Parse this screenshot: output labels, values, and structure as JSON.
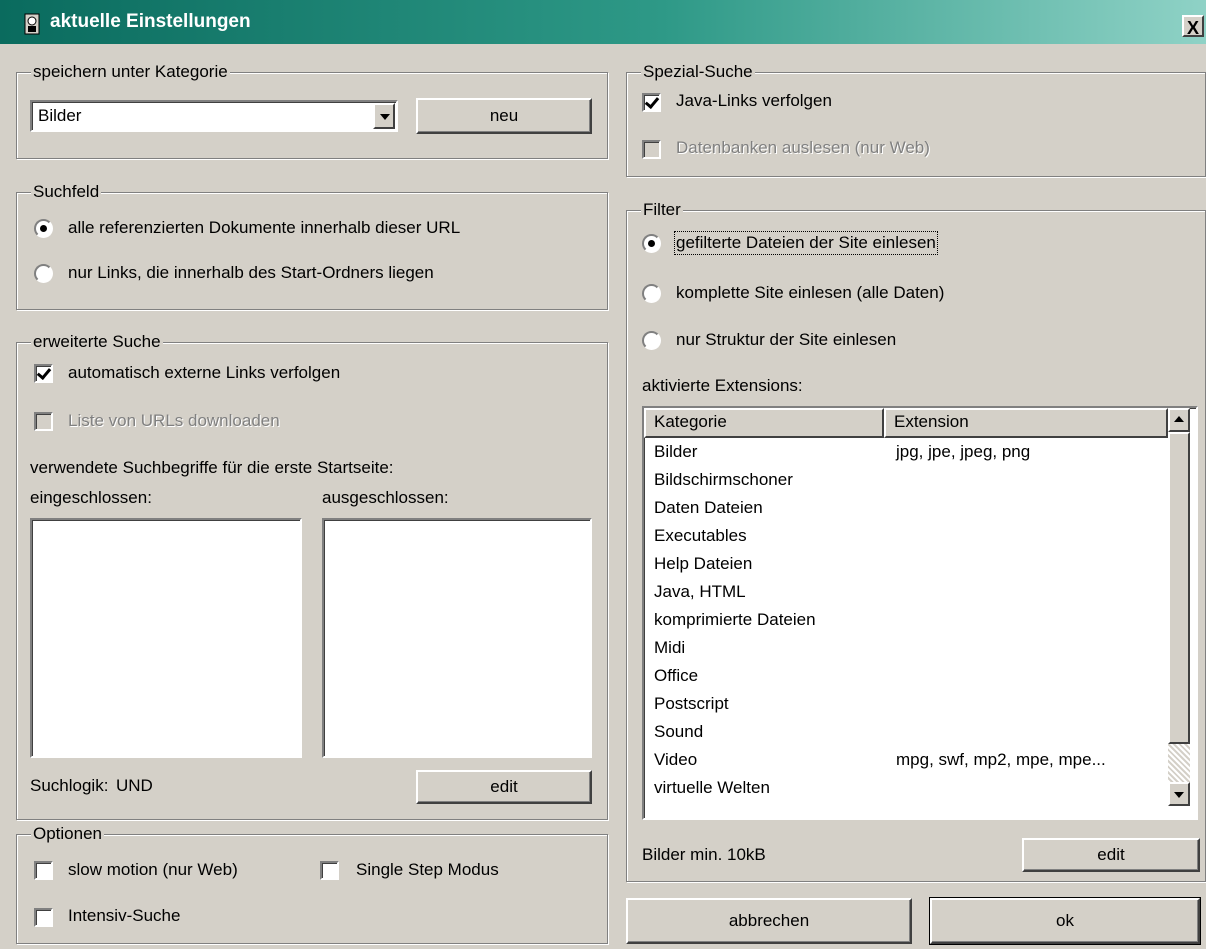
{
  "window": {
    "title": "aktuelle Einstellungen",
    "close_label": "X",
    "title_colors": [
      "#0a6b5e",
      "#2e9987",
      "#8fd2c6"
    ]
  },
  "kategorie": {
    "legend": "speichern unter Kategorie",
    "selected": "Bilder",
    "new_label": "neu"
  },
  "suchfeld": {
    "legend": "Suchfeld",
    "options": [
      {
        "label": "alle referenzierten Dokumente innerhalb dieser URL",
        "checked": true
      },
      {
        "label": "nur Links, die innerhalb des Start-Ordners liegen",
        "checked": false
      }
    ]
  },
  "erweitert": {
    "legend": "erweiterte Suche",
    "auto_links_label": "automatisch externe Links verfolgen",
    "auto_links_checked": true,
    "url_list_label": "Liste von URLs downloaden",
    "url_list_enabled": false,
    "terms_caption": "verwendete Suchbegriffe für die erste Startseite:",
    "included_label": "eingeschlossen:",
    "excluded_label": "ausgeschlossen:",
    "logic_label": "Suchlogik:",
    "logic_value": "UND",
    "edit_label": "edit"
  },
  "optionen": {
    "legend": "Optionen",
    "slow_motion_label": "slow motion (nur Web)",
    "single_step_label": "Single Step Modus",
    "intensive_label": "Intensiv-Suche"
  },
  "spezial": {
    "legend": "Spezial-Suche",
    "java_label": "Java-Links verfolgen",
    "java_checked": true,
    "db_label": "Datenbanken auslesen (nur Web)",
    "db_enabled": false
  },
  "filter": {
    "legend": "Filter",
    "options": [
      {
        "label": "gefilterte Dateien der Site einlesen",
        "checked": true
      },
      {
        "label": "komplette Site einlesen (alle Daten)",
        "checked": false
      },
      {
        "label": "nur Struktur der Site einlesen",
        "checked": false
      }
    ],
    "extensions_caption": "aktivierte Extensions:",
    "columns": [
      "Kategorie",
      "Extension"
    ],
    "rows": [
      [
        "Bilder",
        "jpg, jpe, jpeg, png"
      ],
      [
        "Bildschirmschoner",
        ""
      ],
      [
        "Daten Dateien",
        ""
      ],
      [
        "Executables",
        ""
      ],
      [
        "Help Dateien",
        ""
      ],
      [
        "Java, HTML",
        ""
      ],
      [
        "komprimierte Dateien",
        ""
      ],
      [
        "Midi",
        ""
      ],
      [
        "Office",
        ""
      ],
      [
        "Postscript",
        ""
      ],
      [
        "Sound",
        ""
      ],
      [
        "Video",
        "mpg, swf, mp2, mpe, mpe..."
      ],
      [
        "virtuelle Welten",
        ""
      ]
    ],
    "min_size_label": "Bilder min. 10kB",
    "edit_label": "edit"
  },
  "footer": {
    "cancel_label": "abbrechen",
    "ok_label": "ok"
  }
}
